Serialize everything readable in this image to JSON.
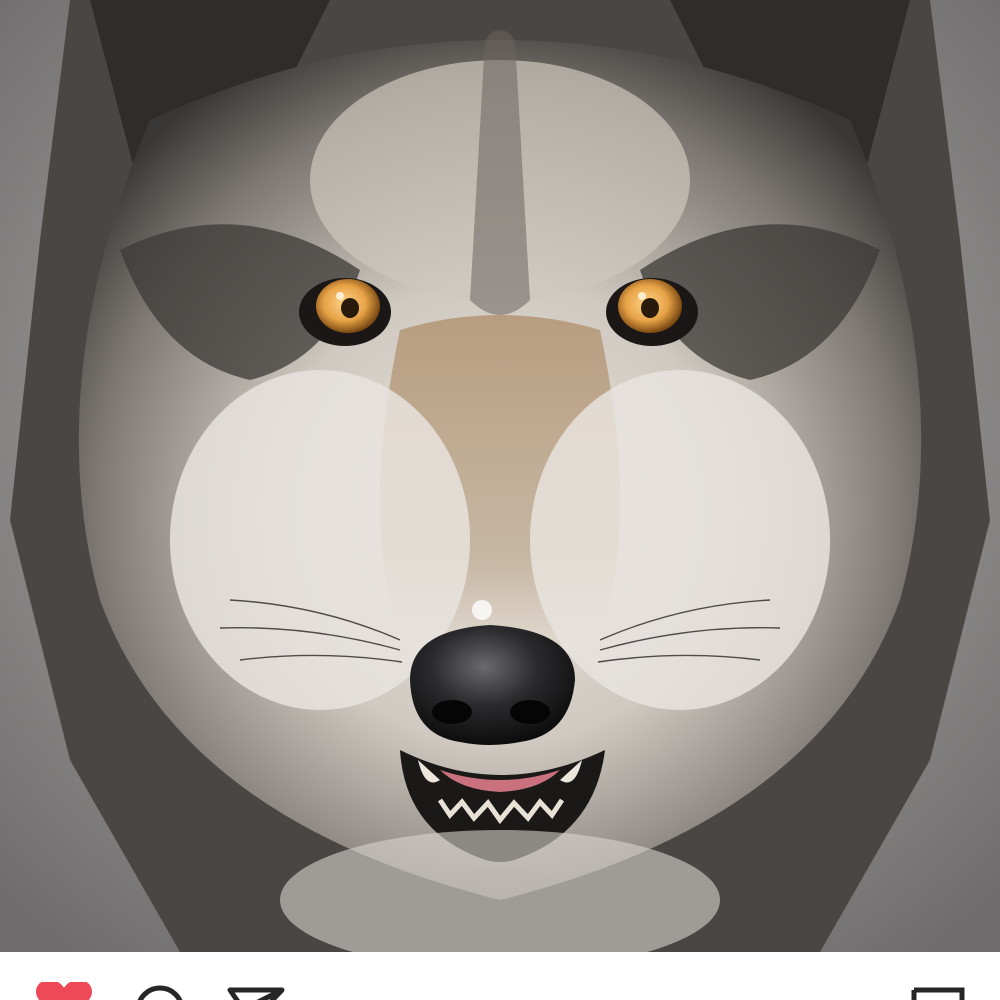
{
  "post": {
    "image": {
      "subject": "wolf-face-photo",
      "background_color": "#8e8c8c"
    },
    "liked": true
  },
  "actions": {
    "like": {
      "icon": "heart-icon",
      "state": "liked",
      "color": "#ed4956"
    },
    "comment": {
      "icon": "speech-bubble-icon",
      "color": "#262626"
    },
    "share": {
      "icon": "paper-plane-icon",
      "color": "#262626"
    },
    "save": {
      "icon": "bookmark-icon",
      "color": "#262626"
    }
  }
}
